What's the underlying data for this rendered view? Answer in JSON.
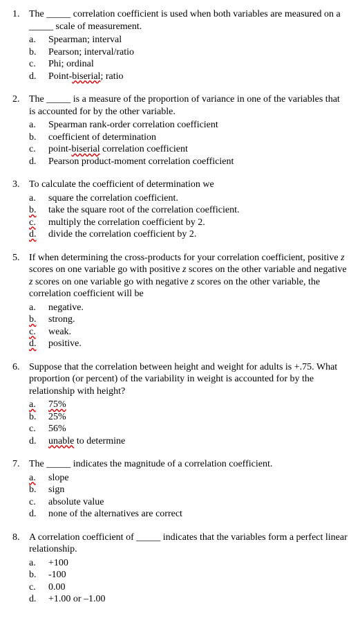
{
  "questions": [
    {
      "num": "1.",
      "stem_parts": [
        {
          "t": "The "
        },
        {
          "t": "_____",
          "u": false
        },
        {
          "t": " correlation coefficient is used when both variables are measured on a "
        },
        {
          "t": "_____",
          "u": false
        },
        {
          "t": " scale of measurement."
        }
      ],
      "opts": [
        {
          "label": "a.",
          "parts": [
            {
              "t": "Spearman; interval"
            }
          ]
        },
        {
          "label": "b.",
          "parts": [
            {
              "t": "Pearson; interval/ratio"
            }
          ]
        },
        {
          "label": "c.",
          "parts": [
            {
              "t": "Phi; ordinal"
            }
          ]
        },
        {
          "label": "d.",
          "parts": [
            {
              "t": "Point-"
            },
            {
              "t": "biserial",
              "sq": true
            },
            {
              "t": "; ratio"
            }
          ]
        }
      ]
    },
    {
      "num": "2.",
      "stem_parts": [
        {
          "t": "The "
        },
        {
          "t": "_____"
        },
        {
          "t": " is a measure of the proportion of variance in one of the variables that is accounted for by the other variable."
        }
      ],
      "opts": [
        {
          "label": "a.",
          "parts": [
            {
              "t": "Spearman rank-order correlation coefficient"
            }
          ]
        },
        {
          "label": "b.",
          "parts": [
            {
              "t": "coefficient of determination"
            }
          ]
        },
        {
          "label": "c.",
          "parts": [
            {
              "t": "point-"
            },
            {
              "t": "biserial",
              "sq": true
            },
            {
              "t": " correlation coefficient"
            }
          ]
        },
        {
          "label": "d.",
          "parts": [
            {
              "t": "Pearson product-moment correlation coefficient"
            }
          ]
        }
      ]
    },
    {
      "num": "3.",
      "stem_parts": [
        {
          "t": "To calculate the coefficient of determination we"
        }
      ],
      "opts": [
        {
          "label": "a.",
          "parts": [
            {
              "t": "square the correlation coefficient."
            }
          ]
        },
        {
          "label_sq": true,
          "label": "b.",
          "parts": [
            {
              "t": "take the square root of the correlation coefficient."
            }
          ]
        },
        {
          "label_sq": true,
          "label": "c.",
          "parts": [
            {
              "t": "multiply the correlation coefficient by 2."
            }
          ]
        },
        {
          "label_sq": true,
          "label": "d.",
          "parts": [
            {
              "t": "divide the correlation coefficient by 2."
            }
          ]
        }
      ]
    },
    {
      "num": "5.",
      "stem_parts": [
        {
          "t": "If when determining the cross-products for your correlation coefficient, positive "
        },
        {
          "t": "z",
          "i": true
        },
        {
          "t": " scores on one variable go with positive "
        },
        {
          "t": "z",
          "i": true
        },
        {
          "t": " scores on the other variable and negative "
        },
        {
          "t": "z",
          "i": true
        },
        {
          "t": " scores on one variable go with negative "
        },
        {
          "t": "z",
          "i": true
        },
        {
          "t": " scores on the other variable, the correlation coefficient will be"
        }
      ],
      "opts": [
        {
          "label": "a.",
          "parts": [
            {
              "t": "negative."
            }
          ]
        },
        {
          "label_sq": true,
          "label": "b.",
          "parts": [
            {
              "t": "strong."
            }
          ]
        },
        {
          "label_sq": true,
          "label": "c.",
          "parts": [
            {
              "t": "weak."
            }
          ]
        },
        {
          "label_sq": true,
          "label": "d.",
          "parts": [
            {
              "t": "positive."
            }
          ]
        }
      ]
    },
    {
      "num": "6.",
      "stem_parts": [
        {
          "t": "Suppose that the correlation between height and weight for adults is +.75. What proportion (or percent) of the variability in weight is accounted for by the relationship with height?"
        }
      ],
      "opts": [
        {
          "label_sq": true,
          "label": "a.",
          "parts": [
            {
              "t": "75%",
              "sq": true
            }
          ]
        },
        {
          "label": "b.",
          "parts": [
            {
              "t": "25%"
            }
          ]
        },
        {
          "label": "c.",
          "parts": [
            {
              "t": "56%"
            }
          ]
        },
        {
          "label": "d.",
          "parts": [
            {
              "t": "unable",
              "sq": true
            },
            {
              "t": " to determine"
            }
          ]
        }
      ]
    },
    {
      "num": "7.",
      "stem_parts": [
        {
          "t": "The "
        },
        {
          "t": "_____"
        },
        {
          "t": " indicates the magnitude of a correlation coefficient."
        }
      ],
      "opts": [
        {
          "label_sq": true,
          "label": "a.",
          "parts": [
            {
              "t": "slope"
            }
          ]
        },
        {
          "label": "b.",
          "parts": [
            {
              "t": "sign"
            }
          ]
        },
        {
          "label": "c.",
          "parts": [
            {
              "t": "absolute value"
            }
          ]
        },
        {
          "label": "d.",
          "parts": [
            {
              "t": "none of the alternatives are correct"
            }
          ]
        }
      ]
    },
    {
      "num": "8.",
      "stem_parts": [
        {
          "t": "A correlation coefficient of "
        },
        {
          "t": "_____"
        },
        {
          "t": " indicates that the variables form a perfect linear relationship."
        }
      ],
      "opts": [
        {
          "label": "a.",
          "parts": [
            {
              "t": "+100"
            }
          ]
        },
        {
          "label": "b.",
          "parts": [
            {
              "t": "-100"
            }
          ]
        },
        {
          "label": "c.",
          "parts": [
            {
              "t": "0.00"
            }
          ]
        },
        {
          "label": "d.",
          "parts": [
            {
              "t": "+1.00 or –1.00"
            }
          ]
        }
      ]
    }
  ]
}
